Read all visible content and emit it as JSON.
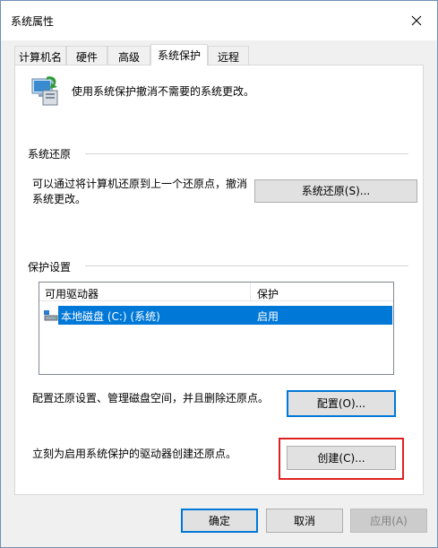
{
  "window": {
    "title": "系统属性"
  },
  "tabs": [
    {
      "label": "计算机名"
    },
    {
      "label": "硬件"
    },
    {
      "label": "高级"
    },
    {
      "label": "系统保护"
    },
    {
      "label": "远程"
    }
  ],
  "intro": {
    "text": "使用系统保护撤消不需要的系统更改。",
    "icon": "system-protection-icon"
  },
  "restore": {
    "group_title": "系统还原",
    "description_line1": "可以通过将计算机还原到上一个还原点，撤消",
    "description_line2": "系统更改。",
    "button_label": "系统还原(S)..."
  },
  "protection": {
    "group_title": "保护设置",
    "columns": [
      "可用驱动器",
      "保护"
    ],
    "rows": [
      {
        "drive": "本地磁盘 (C:) (系统)",
        "protection": "启用",
        "selected": true
      }
    ],
    "configure_text": "配置还原设置、管理磁盘空间，并且删除还原点。",
    "configure_button": "配置(O)...",
    "create_text": "立刻为启用系统保护的驱动器创建还原点。",
    "create_button": "创建(C)..."
  },
  "footer": {
    "ok": "确定",
    "cancel": "取消",
    "apply": "应用(A)"
  },
  "colors": {
    "accent": "#0078d7",
    "highlight": "#e02020"
  }
}
